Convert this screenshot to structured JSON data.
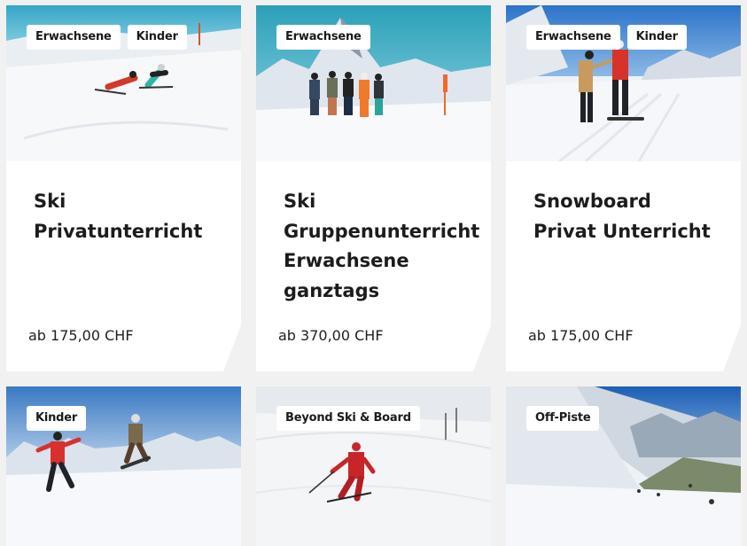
{
  "cards": [
    {
      "title": "Ski Privatunterricht",
      "title_lines": [
        "Ski",
        "Privatunterricht"
      ],
      "price": "ab 175,00 CHF",
      "tags": [
        "Erwachsene",
        "Kinder"
      ]
    },
    {
      "title": "Ski Gruppenunterricht Erwachsene ganztags",
      "title_lines": [
        "Ski",
        "Gruppenunterricht",
        "Erwachsene",
        "ganztags"
      ],
      "price": "ab 370,00 CHF",
      "tags": [
        "Erwachsene"
      ]
    },
    {
      "title": "Snowboard Privat Unterricht",
      "title_lines": [
        "Snowboard",
        "Privat Unterricht"
      ],
      "price": "ab 175,00 CHF",
      "tags": [
        "Erwachsene",
        "Kinder"
      ]
    },
    {
      "tags": [
        "Kinder"
      ]
    },
    {
      "tags": [
        "Beyond Ski & Board"
      ]
    },
    {
      "tags": [
        "Off-Piste"
      ]
    }
  ]
}
